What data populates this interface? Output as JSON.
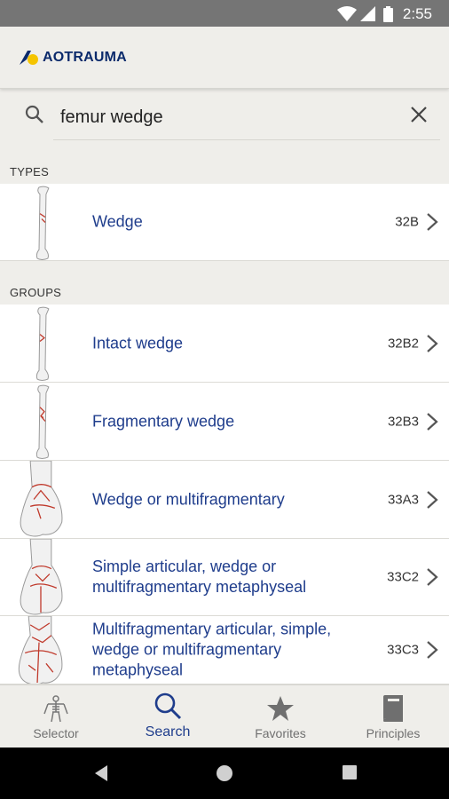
{
  "status": {
    "time": "2:55"
  },
  "app": {
    "logo_text": "AOTRAUMA"
  },
  "search": {
    "query": "femur wedge"
  },
  "sections": {
    "types": "TYPES",
    "groups": "GROUPS"
  },
  "types": [
    {
      "label": "Wedge",
      "code": "32B"
    }
  ],
  "groups": [
    {
      "label": "Intact wedge",
      "code": "32B2"
    },
    {
      "label": "Fragmentary wedge",
      "code": "32B3"
    },
    {
      "label": "Wedge or multifragmentary",
      "code": "33A3"
    },
    {
      "label": "Simple articular, wedge or multifragmentary metaphyseal",
      "code": "33C2"
    },
    {
      "label": "Multifragmentary articular, simple, wedge or multifragmentary metaphyseal",
      "code": "33C3"
    }
  ],
  "nav": {
    "selector": "Selector",
    "search": "Search",
    "favorites": "Favorites",
    "principles": "Principles"
  },
  "colors": {
    "accent": "#1f3d8c",
    "fracture": "#c0392b",
    "logo_yellow": "#f5c400"
  }
}
